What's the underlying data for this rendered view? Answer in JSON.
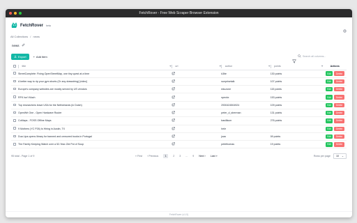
{
  "window": {
    "title": "FetchRover - Free Web Scraper Browser Extension",
    "dot_colors": [
      "#ff5f57",
      "#febc2e",
      "#28c840"
    ]
  },
  "header": {
    "brand": "FetchRover",
    "brand_badge": "beta"
  },
  "breadcrumb": {
    "root": "All Collections",
    "separator": "/",
    "current": "news"
  },
  "collection": {
    "name": "news"
  },
  "toolbar": {
    "export_label": "Export",
    "add_label": "Add item",
    "search_placeholder": "Search all columns..."
  },
  "table": {
    "columns": {
      "title": "title",
      "url": "url",
      "author": "author",
      "points": "points",
      "actions": "Actions"
    },
    "edit_label": "Edit",
    "delete_label": "Delete",
    "rows": [
      {
        "title": "StreetComplete: Fixing OpenStreetMap, one tiny quest at a time",
        "author": "k3tie",
        "points": "130 points"
      },
      {
        "title": "A better way to rip your gym shorts (Or any drawstring) [video]",
        "author": "sunprisetalk",
        "points": "107 points"
      },
      {
        "title": "Europe's company websites are mostly served by US vendors",
        "author": "eduzone",
        "points": "115 points"
      },
      {
        "title": "RFK Isn't Much",
        "author": "speckx",
        "points": "153 points"
      },
      {
        "title": "Top researchers leave USA for the Netherlands (in Dutch)",
        "author": "2930424504924",
        "points": "109 points"
      },
      {
        "title": "OpenWrt One - Open Hardware Router",
        "author": "peter_d_sherman",
        "points": "131 points"
      },
      {
        "title": "CoMaps - FOSS Offline Maps",
        "author": "basilikum",
        "points": "276 points"
      },
      {
        "title": "9 Mothers (YC P26) Is Hiring in Austin, TX",
        "author": "hele",
        "points": ""
      },
      {
        "title": "Dua Lipa opens library for banned and censored books in Portugal",
        "author": "joao",
        "points": "69 points"
      },
      {
        "title": "The Family Keeping Watch over a 52-Year-Old Pot of Soup",
        "author": "petethomas",
        "points": "19 points"
      }
    ]
  },
  "footer": {
    "summary": "95 total - Page 1 of 9",
    "first": "First",
    "previous": "Previous",
    "pages": [
      "1",
      "2",
      "3",
      "...",
      "9"
    ],
    "active_page": "1",
    "next": "Next",
    "last": "Last",
    "rows_per_page_label": "Rows per page",
    "rows_per_page_value": "10"
  },
  "bottom_bar": {
    "text": "FetchRover (v1.0)"
  },
  "colors": {
    "accent": "#14b8a6",
    "edit": "#22c55e",
    "delete": "#f87171"
  }
}
